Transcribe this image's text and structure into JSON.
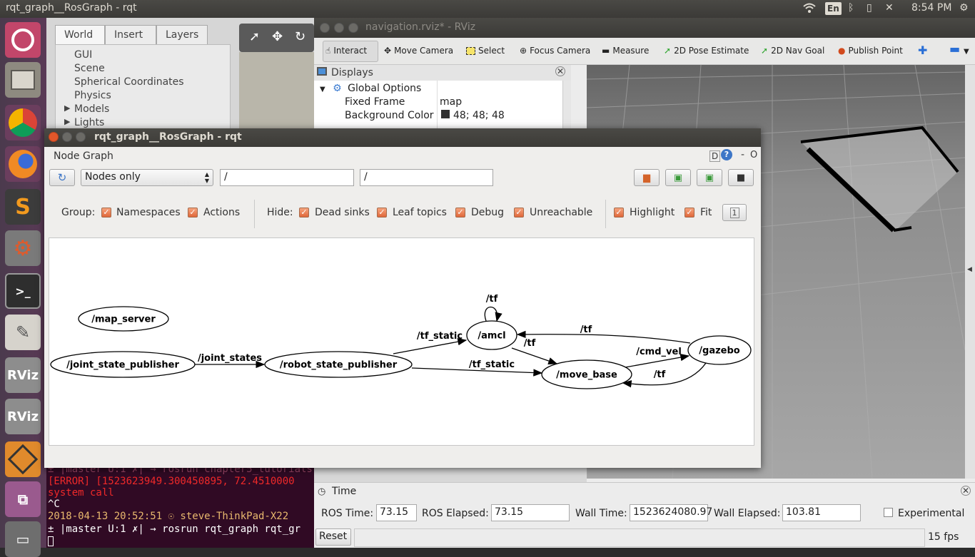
{
  "topbar": {
    "title": "rqt_graph__RosGraph - rqt",
    "lang": "En",
    "clock": "8:54 PM"
  },
  "launcher": {
    "items": [
      "ubuntu-icon",
      "files-icon",
      "chrome-icon",
      "firefox-icon",
      "sublime-icon",
      "settings-icon",
      "terminal-icon",
      "text-editor-icon",
      "rviz-icon",
      "rviz-icon",
      "gazebo-icon",
      "network-icon",
      "trash-icon"
    ],
    "rviz_label": "RViz"
  },
  "gazebo": {
    "tabs": [
      "World",
      "Insert",
      "Layers"
    ],
    "tree": [
      "GUI",
      "Scene",
      "Spherical Coordinates",
      "Physics",
      "Models",
      "Lights"
    ]
  },
  "rviz": {
    "title": "navigation.rviz* - RViz",
    "tools": [
      "Interact",
      "Move Camera",
      "Select",
      "Focus Camera",
      "Measure",
      "2D Pose Estimate",
      "2D Nav Goal",
      "Publish Point"
    ],
    "displays": {
      "header": "Displays",
      "global_options": "Global Options",
      "fixed_frame_label": "Fixed Frame",
      "fixed_frame_value": "map",
      "background_label": "Background Color",
      "background_value": "48; 48; 48"
    },
    "time": {
      "header": "Time",
      "ros_time_label": "ROS Time:",
      "ros_time": "73.15",
      "ros_elapsed_label": "ROS Elapsed:",
      "ros_elapsed": "73.15",
      "wall_time_label": "Wall Time:",
      "wall_time": "1523624080.97",
      "wall_elapsed_label": "Wall Elapsed:",
      "wall_elapsed": "103.81",
      "experimental": "Experimental",
      "reset": "Reset",
      "fps": "15 fps"
    }
  },
  "terminal": {
    "lines": [
      "± |master U:1 ✗| → rosrun chapter5_tutorials",
      "[ERROR] [1523623949.300450895, 72.4510000",
      " system call",
      "^C",
      " 2018-04-13 20:52:51 ☉ steve-ThinkPad-X22",
      "± |master U:1 ✗| → rosrun rqt_graph rqt_gr"
    ]
  },
  "rqt": {
    "title": "rqt_graph__RosGraph - rqt",
    "plugin_title": "Node Graph",
    "plugin_controls": "D",
    "filter_mode": "Nodes only",
    "ns_filter": "/",
    "topic_filter": "/",
    "group_label": "Group:",
    "hide_label": "Hide:",
    "options": {
      "namespaces": "Namespaces",
      "actions": "Actions",
      "dead_sinks": "Dead sinks",
      "leaf_topics": "Leaf topics",
      "debug": "Debug",
      "unreachable": "Unreachable",
      "highlight": "Highlight",
      "fit": "Fit"
    },
    "graph": {
      "nodes": [
        "/map_server",
        "/joint_state_publisher",
        "/robot_state_publisher",
        "/amcl",
        "/move_base",
        "/gazebo"
      ],
      "edges": [
        "/tf",
        "/joint_states",
        "/tf_static",
        "/tf",
        "/tf_static",
        "/tf",
        "/cmd_vel",
        "/tf"
      ]
    }
  }
}
